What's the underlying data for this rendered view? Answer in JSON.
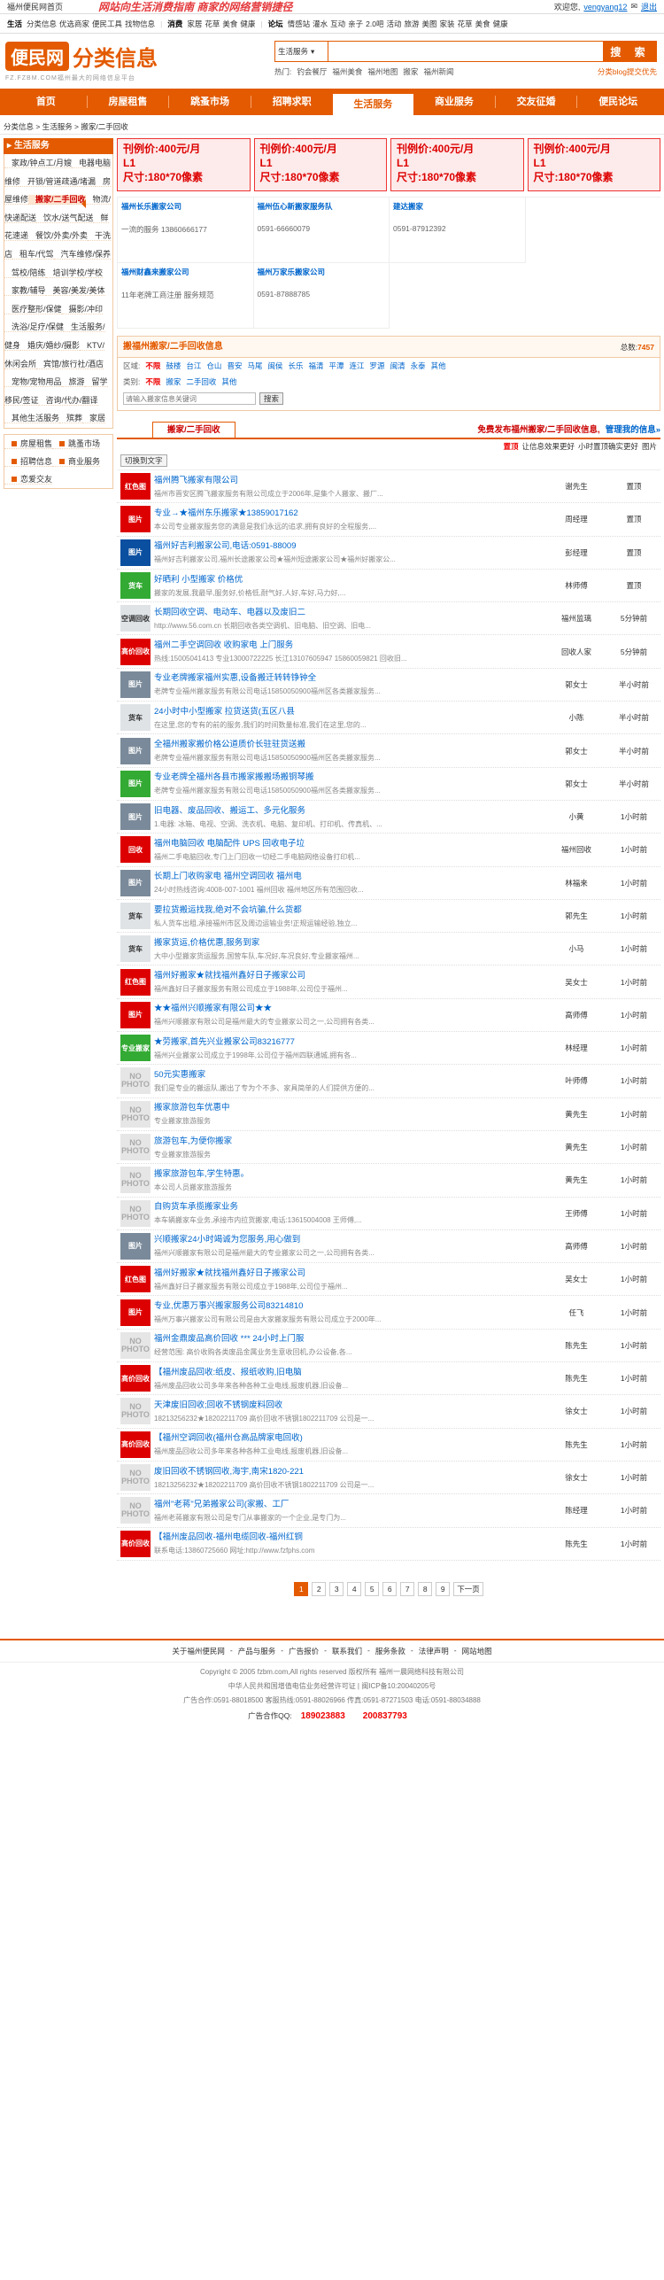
{
  "topbar": {
    "home": "福州便民网首页",
    "slogan": "网站向生活消费指南 商家的网络营销捷径",
    "welcome": "欢迎您,",
    "nickname": "vengyang12",
    "logout": "退出"
  },
  "catstrip": {
    "groups": [
      {
        "label": "生活",
        "items": [
          "分类信息",
          "优选商家",
          "便民工具",
          "找物信息"
        ]
      },
      {
        "label": "消费",
        "items": [
          "家居",
          "花草",
          "美食",
          "健康"
        ]
      },
      {
        "label": "论坛",
        "items": [
          "情感站",
          "灌水",
          "互动",
          "亲子",
          "2.0吧",
          "活动",
          "旅游",
          "美图",
          "家装",
          "花草",
          "美食",
          "健康"
        ]
      }
    ]
  },
  "header": {
    "logo_badge": "便民网",
    "logo_text": "分类信息",
    "logo_sub": "FZ.FZBM.COM福州最大的网络信息平台",
    "search_select": "生活服务",
    "search_placeholder": "",
    "search_button": "搜 索",
    "hot_label": "热门:",
    "hot": [
      "钓会餐厅",
      "福州美食",
      "福州地图",
      "搬家",
      "福州新闻"
    ],
    "hot_tip": "分类blog提交优先"
  },
  "nav": [
    "首页",
    "房屋租售",
    "跳蚤市场",
    "招聘求职",
    "生活服务",
    "商业服务",
    "交友征婚",
    "便民论坛"
  ],
  "nav_active": 4,
  "breadcrumb": "分类信息 > 生活服务 > 搬家/二手回收",
  "sidebar": {
    "title": "生活服务",
    "items": [
      "家政/钟点工/月嫂",
      "电器电脑维修",
      "开锁/管道疏通/堵漏",
      "房屋维修",
      "搬家/二手回收",
      "物流/快递配送",
      "饮水/送气配送",
      "鲜花速递",
      "餐饮/外卖/外卖",
      "干洗店",
      "租车/代驾",
      "汽车维修/保养",
      "驾校/陪练",
      "培训学校/学校",
      "家教/辅导",
      "美容/美发/美体",
      "医疗整形/保健",
      "摄影/冲印",
      "洗浴/足疗/保健",
      "生活服务/健身",
      "婚庆/婚纱/摄影",
      "KTV/休闲会所",
      "宾馆/旅行社/酒店",
      "宠物/宠物用品",
      "旅游",
      "留学移民/签证",
      "咨询/代办/翻译",
      "其他生活服务",
      "殡葬",
      "家居"
    ],
    "active": 4,
    "others": [
      "房屋租售",
      "跳蚤市场",
      "招聘信息",
      "商业服务",
      "恋爱交友"
    ]
  },
  "ads": [
    {
      "title": "刊例价:400元/月",
      "code": "L1",
      "size": "尺寸:180*70像素"
    },
    {
      "title": "刊例价:400元/月",
      "code": "L1",
      "size": "尺寸:180*70像素"
    },
    {
      "title": "刊例价:400元/月",
      "code": "L1",
      "size": "尺寸:180*70像素"
    },
    {
      "title": "刊例价:400元/月",
      "code": "L1",
      "size": "尺寸:180*70像素"
    }
  ],
  "tiles": [
    {
      "name": "福州长乐搬家公司",
      "desc": "一流的服务 13860666177"
    },
    {
      "name": "福州伍心新搬家服务队",
      "desc": "0591-66660079"
    },
    {
      "name": "建达搬家",
      "desc": "0591-87912392"
    },
    {
      "name": "福州财鑫来搬家公司",
      "desc": "11年老牌工商注册 服务规范"
    },
    {
      "name": "福州万家乐搬家公司",
      "desc": "0591-87888785"
    }
  ],
  "filter": {
    "title": "搬福州搬家/二手回收信息",
    "total_label": "总数:",
    "total": "7457",
    "area_label": "区域:",
    "areas": [
      "不限",
      "鼓楼",
      "台江",
      "仓山",
      "晋安",
      "马尾",
      "闽侯",
      "长乐",
      "福清",
      "平潭",
      "连江",
      "罗源",
      "闽清",
      "永泰",
      "其他"
    ],
    "type_label": "类别:",
    "types": [
      "不限",
      "搬家",
      "二手回收",
      "其他"
    ],
    "search_placeholder": "请输入搬家信息关键词",
    "search_button": "搜索"
  },
  "tabs": {
    "tab": "搬家/二手回收",
    "promo": "免费发布福州搬家/二手回收信息,",
    "promo_link": "管理我的信息»"
  },
  "sortbar": [
    "置顶",
    "让信息效果更好",
    "小时置顶确实更好",
    "图片"
  ],
  "toggle": "切换到文字",
  "listings": [
    {
      "title": "福州腾飞搬家有限公司",
      "desc": "福州市晋安区腾飞搬家服务有限公司成立于2006年,是集个人搬家、搬厂...",
      "person": "谢先生",
      "time": "置顶",
      "thumb": "红色图",
      "style": "th-red"
    },
    {
      "title": "专业→★福州东乐搬家★13859017162",
      "desc": "本公司专业搬家服务您的满意是我们永远的追求,拥有良好的全程服务,...",
      "person": "周经理",
      "time": "置顶",
      "thumb": "图片",
      "style": "th-red"
    },
    {
      "title": "福州好吉利搬家公司,电话:0591-88009",
      "desc": "福州好吉利搬家公司,福州长途搬家公司★福州短途搬家公司★福州好搬家公...",
      "person": "彭经理",
      "time": "置顶",
      "thumb": "图片",
      "style": "th-blue"
    },
    {
      "title": "好晒利 小型搬家 价格优",
      "desc": "搬家的发展,我最早,服务好,价格低,耐气好,人好,车好,马力好,...",
      "person": "林师傅",
      "time": "置顶",
      "thumb": "货车",
      "style": "th-green"
    },
    {
      "title": "长期回收空调、电动车、电器以及废旧二",
      "desc": "http://www.56.com.cn 长期回收各类空调机、旧电脑、旧空调、旧电...",
      "person": "福州监璃",
      "time": "5分钟前",
      "thumb": "空调回收",
      "style": "th-truck"
    },
    {
      "title": "福州二手空调回收 收购家电 上门服务",
      "desc": "热线:15005041413 专业13000722225 长江13107605947 15860059821 回收旧...",
      "person": "回收人家",
      "time": "5分钟前",
      "thumb": "高价回收",
      "style": "th-red"
    },
    {
      "title": "专业老牌搬家福州实惠,设备搬迁转转铮钟全",
      "desc": "老牌专业福州搬家服务有限公司电话15850050900福州区各类搬家服务...",
      "person": "郭女士",
      "time": "半小时前",
      "thumb": "图片",
      "style": "th-photo"
    },
    {
      "title": "24小时中小型搬家 拉货送货(五区八县",
      "desc": "在这里,您的专有的前的服务,我们的时间数量标准,我们在这里,您的...",
      "person": "小陈",
      "time": "半小时前",
      "thumb": "货车",
      "style": "th-truck"
    },
    {
      "title": "全福州搬家搬价格公道质价长驻驻货送搬",
      "desc": "老牌专业福州搬家服务有限公司电话15850050900福州区各类搬家服务...",
      "person": "郭女士",
      "time": "半小时前",
      "thumb": "图片",
      "style": "th-photo"
    },
    {
      "title": "专业老牌全福州各县市搬家搬搬场搬铜琴搬",
      "desc": "老牌专业福州搬家服务有限公司电话15850050900福州区各类搬家服务...",
      "person": "郭女士",
      "time": "半小时前",
      "thumb": "图片",
      "style": "th-green"
    },
    {
      "title": "旧电器、废品回收、搬运工、多元化服务",
      "desc": "1.电器: 冰箱、电视、空调、洗衣机、电脑、复印机、打印机、传真机、...",
      "person": "小黄",
      "time": "1小时前",
      "thumb": "图片",
      "style": "th-photo"
    },
    {
      "title": "福州电脑回收 电脑配件 UPS 回收电子垃",
      "desc": "福州二手电脑回收,专门上门回收一切经二手电脑网络设备打印机...",
      "person": "福州回收",
      "time": "1小时前",
      "thumb": "回收",
      "style": "th-red"
    },
    {
      "title": "长期上门收购家电 福州空调回收 福州电",
      "desc": "24小时热线咨询:4008-007-1001 福州回收 福州地区所有范围回收...",
      "person": "林福来",
      "time": "1小时前",
      "thumb": "图片",
      "style": "th-photo"
    },
    {
      "title": "要拉货搬运找我,绝对不会坑骗,什么货都",
      "desc": "私人货车出租,承接福州市区及周边运输业务!正规运输经验,独立...",
      "person": "郭先生",
      "time": "1小时前",
      "thumb": "货车",
      "style": "th-truck"
    },
    {
      "title": "搬家货运,价格优惠,服务到家",
      "desc": "大中小型搬家货运服务,国营车队,车况好,车况良好,专业搬家福州...",
      "person": "小马",
      "time": "1小时前",
      "thumb": "货车",
      "style": "th-truck"
    },
    {
      "title": "福州好搬家★就找福州鑫好日子搬家公司",
      "desc": "福州鑫好日子搬家服务有限公司成立于1988年,公司位于福州...",
      "person": "吴女士",
      "time": "1小时前",
      "thumb": "红色图",
      "style": "th-red"
    },
    {
      "title": "★★福州兴顺搬家有限公司★★",
      "desc": "福州兴顺搬家有限公司是福州最大的专业搬家公司之一,公司拥有各类...",
      "person": "高师傅",
      "time": "1小时前",
      "thumb": "图片",
      "style": "th-red"
    },
    {
      "title": "★劳搬家,首先兴业搬家公司83216777",
      "desc": "福州兴业搬家公司成立于1998年,公司位于福州四联通城,拥有各...",
      "person": "林经理",
      "time": "1小时前",
      "thumb": "专业搬家",
      "style": "th-green"
    },
    {
      "title": "50元实惠搬家",
      "desc": "我们是专业的搬运队,搬出了专为个不多、家具简单的人们提供方便的...",
      "person": "叶师傅",
      "time": "1小时前",
      "thumb": "NO PHOTO",
      "style": "th-nophoto"
    },
    {
      "title": "搬家旅游包车优惠中",
      "desc": "专业搬家旅游服务",
      "person": "黄先生",
      "time": "1小时前",
      "thumb": "NO PHOTO",
      "style": "th-nophoto"
    },
    {
      "title": "旅游包车,为便你搬家",
      "desc": "专业搬家旅游服务",
      "person": "黄先生",
      "time": "1小时前",
      "thumb": "NO PHOTO",
      "style": "th-nophoto"
    },
    {
      "title": "搬家旅游包车,学生特惠。",
      "desc": "本公司人员搬家旅游服务",
      "person": "黄先生",
      "time": "1小时前",
      "thumb": "NO PHOTO",
      "style": "th-nophoto"
    },
    {
      "title": "自购货车承揽搬家业务",
      "desc": "本车辆搬家车业务,承接市内拉货搬家,电话:13615004008 王师傅,...",
      "person": "王师傅",
      "time": "1小时前",
      "thumb": "NO PHOTO",
      "style": "th-nophoto"
    },
    {
      "title": "兴顺搬家24小时竭诚为您服务,用心做到",
      "desc": "福州兴顺搬家有限公司是福州最大的专业搬家公司之一,公司拥有各类...",
      "person": "高师傅",
      "time": "1小时前",
      "thumb": "图片",
      "style": "th-photo"
    },
    {
      "title": "福州好搬家★就找福州鑫好日子搬家公司",
      "desc": "福州鑫好日子搬家服务有限公司成立于1988年,公司位于福州...",
      "person": "吴女士",
      "time": "1小时前",
      "thumb": "红色图",
      "style": "th-red"
    },
    {
      "title": "专业,优惠万事兴搬家服务公司83214810",
      "desc": "福州万事兴搬家公司有限公司是由大家搬家服务有限公司成立于2000年...",
      "person": "任飞",
      "time": "1小时前",
      "thumb": "图片",
      "style": "th-red"
    },
    {
      "title": "福州金鼎废品高价回收 *** 24小时上门服",
      "desc": "经营范围: 高价收购各类废品金属业务生意收回机,办公设备,各...",
      "person": "陈先生",
      "time": "1小时前",
      "thumb": "NO PHOTO",
      "style": "th-nophoto"
    },
    {
      "title": "【福州废品回收:纸皮、报纸收购,旧电脑",
      "desc": "福州废品回收公司多年来各种各种工业电线,报废机器,旧设备...",
      "person": "陈先生",
      "time": "1小时前",
      "thumb": "高价回收",
      "style": "th-red"
    },
    {
      "title": "天津废旧回收;回收不锈钢废料回收",
      "desc": "18213256232★18202211709 高价回收不锈钢1802211709 公司是一...",
      "person": "徐女士",
      "time": "1小时前",
      "thumb": "NO PHOTO",
      "style": "th-nophoto"
    },
    {
      "title": "【福州空调回收(福州仓高品牌家电回收)",
      "desc": "福州废品回收公司多年来各种各种工业电线,报废机器,旧设备...",
      "person": "陈先生",
      "time": "1小时前",
      "thumb": "高价回收",
      "style": "th-red"
    },
    {
      "title": "废旧回收不锈钢回收,海宇,南宋1820-221",
      "desc": "18213256232★18202211709 高价回收不锈钢1802211709 公司是一...",
      "person": "徐女士",
      "time": "1小时前",
      "thumb": "NO PHOTO",
      "style": "th-nophoto"
    },
    {
      "title": "福州\"老蒋\"兄弟搬家公司(家搬、工厂",
      "desc": "福州老蒋搬家有限公司是专门从事搬家的一个企业,是专门为...",
      "person": "陈经理",
      "time": "1小时前",
      "thumb": "NO PHOTO",
      "style": "th-nophoto"
    },
    {
      "title": "【福州废品回收-福州电缆回收-福州红铜",
      "desc": "联系电话:13860725660 网址:http://www.fzfphs.com",
      "person": "陈先生",
      "time": "1小时前",
      "thumb": "高价回收",
      "style": "th-red"
    }
  ],
  "pager": [
    "1",
    "2",
    "3",
    "4",
    "5",
    "6",
    "7",
    "8",
    "9",
    "下一页"
  ],
  "footer": {
    "links": [
      "关于福州便民网",
      "产品与服务",
      "广告报价",
      "联系我们",
      "服务条款",
      "法律声明",
      "网站地图"
    ],
    "copyright": "Copyright © 2005 fzbm.com,All rights reserved 版权所有 福州一晨网络科技有限公司",
    "icp": "中华人民共和国增值电信业务经营许可证 | 闽ICP备10:20040205号",
    "phone_line": "广告合作:0591-88018500 客服热线:0591-88026966 传真:0591-87271503 电话:0591-88034888",
    "ad_label": "广告合作QQ:",
    "qq1": "189023883",
    "qq2": "200837793"
  }
}
